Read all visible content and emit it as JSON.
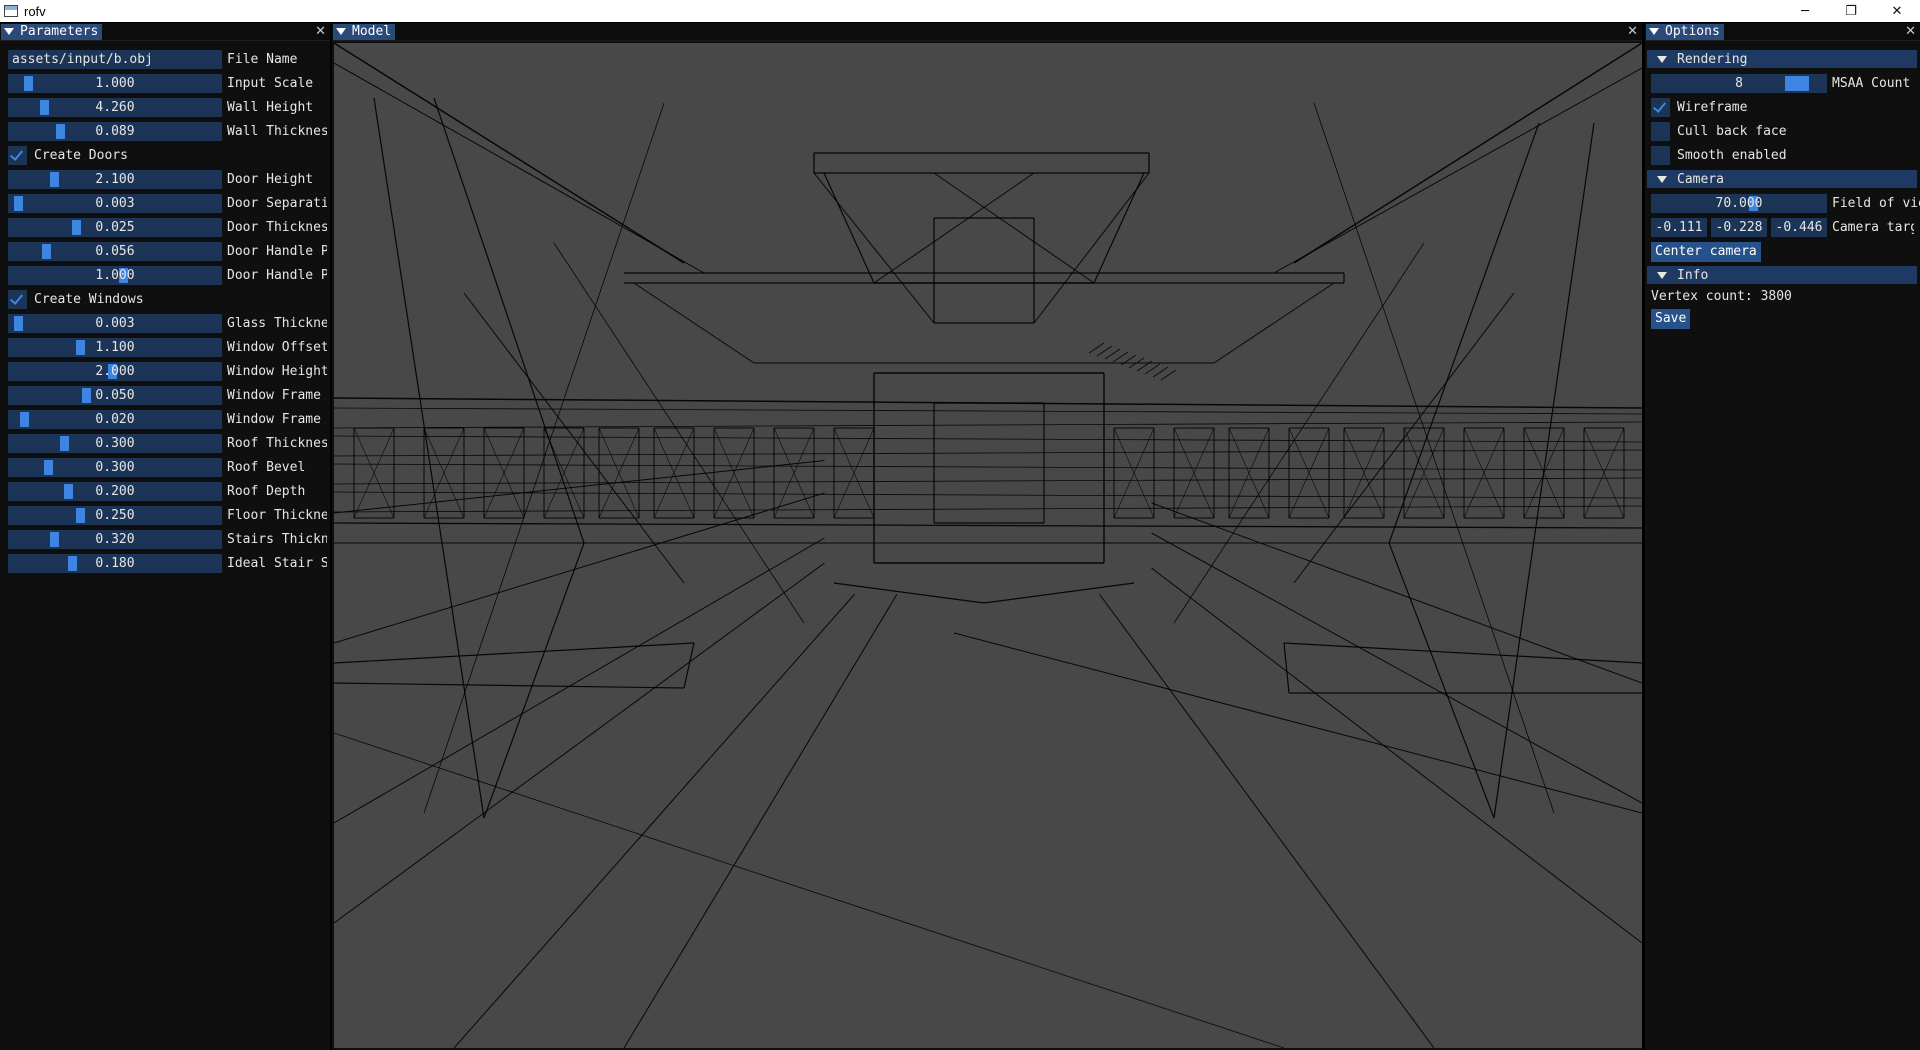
{
  "window": {
    "title": "rofv",
    "controls": {
      "minimize": "─",
      "maximize": "❐",
      "close": "✕"
    }
  },
  "parameters": {
    "title": "Parameters",
    "close": "✕",
    "file_name": {
      "value": "assets/input/b.obj",
      "label": "File Name"
    },
    "sliders": [
      {
        "value": "1.000",
        "label": "Input Scale",
        "fraction": 0.07
      },
      {
        "value": "4.260",
        "label": "Wall Height",
        "fraction": 0.15
      },
      {
        "value": "0.089",
        "label": "Wall Thickness",
        "fraction": 0.23
      }
    ],
    "create_doors": {
      "label": "Create Doors",
      "checked": true
    },
    "door_sliders": [
      {
        "value": "2.100",
        "label": "Door Height",
        "fraction": 0.2
      },
      {
        "value": "0.003",
        "label": "Door Separation",
        "fraction": 0.02
      },
      {
        "value": "0.025",
        "label": "Door Thickness",
        "fraction": 0.31
      },
      {
        "value": "0.056",
        "label": "Door Handle Pos",
        "fraction": 0.16
      },
      {
        "value": "1.000",
        "label": "Door Handle Pos",
        "fraction": 0.54
      }
    ],
    "create_windows": {
      "label": "Create Windows",
      "checked": true
    },
    "window_sliders": [
      {
        "value": "0.003",
        "label": "Glass Thickness",
        "fraction": 0.02
      },
      {
        "value": "1.100",
        "label": "Window Offset",
        "fraction": 0.33
      },
      {
        "value": "2.000",
        "label": "Window Height",
        "fraction": 0.49
      },
      {
        "value": "0.050",
        "label": "Window Frame W",
        "fraction": 0.36
      },
      {
        "value": "0.020",
        "label": "Window Frame Th",
        "fraction": 0.05
      },
      {
        "value": "0.300",
        "label": "Roof Thickness",
        "fraction": 0.25
      },
      {
        "value": "0.300",
        "label": "Roof Bevel",
        "fraction": 0.17
      },
      {
        "value": "0.200",
        "label": "Roof Depth",
        "fraction": 0.27
      },
      {
        "value": "0.250",
        "label": "Floor Thickness",
        "fraction": 0.33
      },
      {
        "value": "0.320",
        "label": "Stairs Thickness",
        "fraction": 0.2
      },
      {
        "value": "0.180",
        "label": "Ideal Stair Step",
        "fraction": 0.29
      }
    ]
  },
  "model": {
    "title": "Model",
    "close": "✕"
  },
  "options": {
    "title": "Options",
    "close": "✕",
    "rendering": {
      "header": "Rendering",
      "msaa": {
        "value": "8",
        "label": "MSAA Count",
        "fraction": 0.88
      },
      "wireframe": {
        "label": "Wireframe",
        "checked": true
      },
      "cull_back_face": {
        "label": "Cull back face",
        "checked": false
      },
      "smooth_enabled": {
        "label": "Smooth enabled",
        "checked": false
      }
    },
    "camera": {
      "header": "Camera",
      "fov": {
        "value": "70.000",
        "label": "Field of view",
        "fraction": 0.59
      },
      "target": {
        "x": "-0.111",
        "y": "-0.228",
        "z": "-0.446",
        "label": "Camera target"
      },
      "center_button": "Center camera"
    },
    "info": {
      "header": "Info",
      "vertex_count": "Vertex count: 3800",
      "save_button": "Save"
    }
  },
  "colors": {
    "frame_bg": "#1c3556",
    "slider_grab": "#3d85e0",
    "header": "#1e3a62",
    "button": "#26518a",
    "viewport_bg": "#484848",
    "window_bg": "#0f0f0f"
  }
}
